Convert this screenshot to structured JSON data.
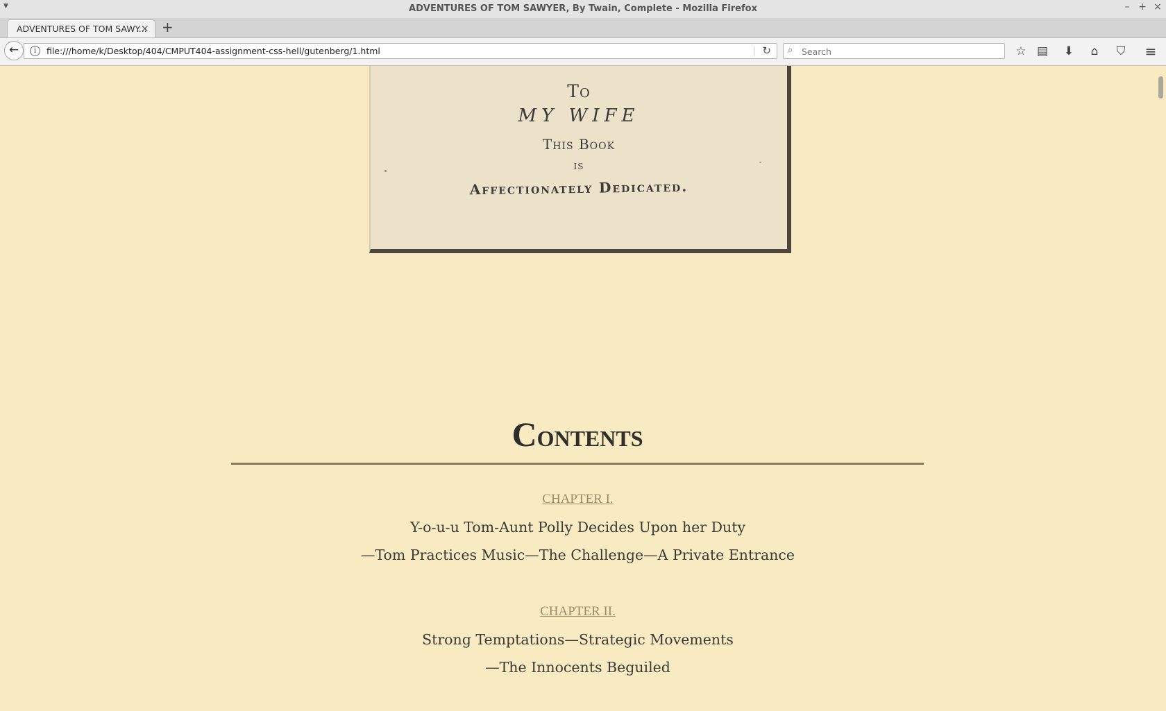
{
  "window": {
    "title": "ADVENTURES OF TOM SAWYER, By Twain, Complete - Mozilla Firefox",
    "controls": {
      "minimize": "–",
      "maximize": "+",
      "close": "×"
    }
  },
  "tabs": [
    {
      "label": "ADVENTURES OF TOM SAWY...",
      "close": "×",
      "active": true
    }
  ],
  "new_tab_label": "+",
  "navbar": {
    "back_icon": "←",
    "info_icon": "i",
    "url": "file:///home/k/Desktop/404/CMPUT404-assignment-css-hell/gutenberg/1.html",
    "reload_icon": "↻",
    "search_placeholder": "Search",
    "search_icon": "⌕",
    "tools": {
      "bookmark": "☆",
      "reading_list": "▤",
      "downloads": "⬇",
      "home": "⌂",
      "pocket": "⛉",
      "menu": "≡"
    }
  },
  "dedication": {
    "line1": "To",
    "line2": "MY WIFE",
    "line3": "This Book",
    "line4": "is",
    "line5": "Affectionately Dedicated."
  },
  "contents": {
    "heading_cap": "C",
    "heading_rest": "ONTENTS",
    "chapters": [
      {
        "title": "CHAPTER I.",
        "lines": [
          "Y-o-u-u Tom-Aunt Polly Decides Upon her Duty",
          "—Tom Practices Music—The Challenge—A Private Entrance"
        ]
      },
      {
        "title": "CHAPTER II.",
        "lines": [
          "Strong Temptations—Strategic Movements",
          "—The Innocents Beguiled"
        ]
      }
    ]
  },
  "colors": {
    "page_background": "#f8ebc2",
    "link": "#9b8b68",
    "text": "#3b3a36",
    "rule": "#8b7a58"
  }
}
